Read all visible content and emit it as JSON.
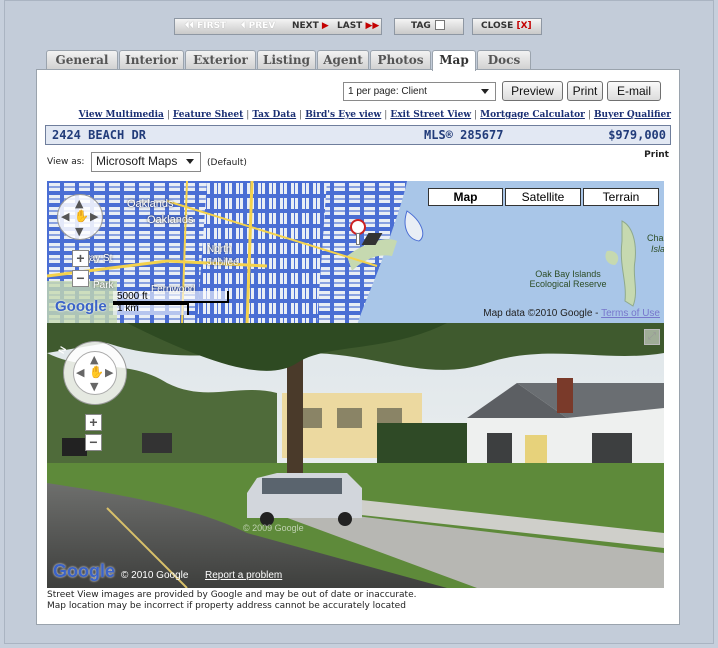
{
  "toolbar": {
    "first": "FIRST",
    "prev": "PREV",
    "next": "NEXT",
    "last": "LAST",
    "tag": "TAG",
    "close": "CLOSE",
    "close_x": "[X]"
  },
  "tabs": [
    "General",
    "Interior",
    "Exterior",
    "Listing",
    "Agent",
    "Photos",
    "Map",
    "Docs"
  ],
  "active_tab": "Map",
  "report_select": {
    "value": "1 per page: Client"
  },
  "buttons": {
    "preview": "Preview",
    "print": "Print",
    "email": "E-mail"
  },
  "links": [
    "View Multimedia",
    "Feature Sheet",
    "Tax Data",
    "Bird's Eye view",
    "Exit Street View",
    "Mortgage Calculator",
    "Buyer Qualifier"
  ],
  "listing": {
    "address": "2424 BEACH DR",
    "mls": "MLS® 285677",
    "price": "$979,000"
  },
  "view_as": {
    "label": "View as:",
    "value": "Microsoft Maps",
    "default_note": "(Default)",
    "print": "Print"
  },
  "map": {
    "types": [
      "Map",
      "Satellite",
      "Terrain"
    ],
    "active_type": "Map",
    "labels": {
      "oaklands1": "Oaklands",
      "oaklands2": "Oaklands",
      "north": "North",
      "jubilee": "Jubilee",
      "bay_st": "Bay St",
      "park": "Park",
      "fernwood": "Fernwood",
      "scale_ft": "5000 ft",
      "scale_km": "1 km",
      "island": "Oak Bay Islands Ecological Reserve",
      "cha": "Cha",
      "isla": "Isla"
    },
    "attribution": "Map data ©2010 Google - ",
    "terms": "Terms of Use",
    "google": "Google"
  },
  "streetview": {
    "google": "Google",
    "copyright": "© 2010 Google",
    "report": "Report a problem",
    "watermark": "© 2009 Google"
  },
  "notes": [
    "Street View images are provided by Google and may be out of date or inaccurate.",
    "Map location may be incorrect if property address cannot be accurately located"
  ],
  "colors": {
    "accent": "#1a2f73",
    "map_water": "#a9c6e8",
    "map_blocks": "#4a6ed4",
    "close_red": "#c40000"
  }
}
